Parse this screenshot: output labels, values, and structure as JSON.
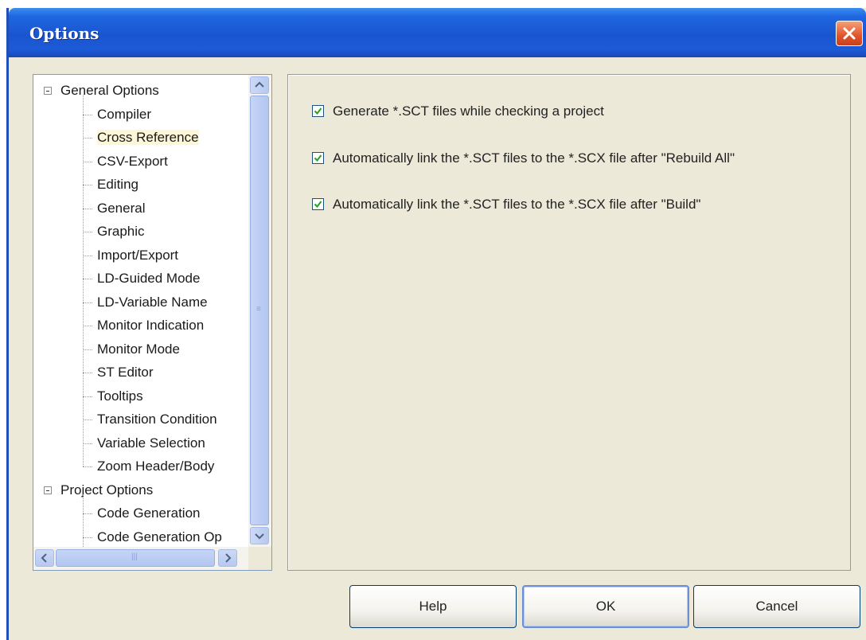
{
  "window": {
    "title": "Options"
  },
  "tree": {
    "items": [
      {
        "label": "General Options",
        "level": 0,
        "expanded": true
      },
      {
        "label": "Compiler",
        "level": 1
      },
      {
        "label": "Cross Reference",
        "level": 1,
        "selected": true
      },
      {
        "label": "CSV-Export",
        "level": 1
      },
      {
        "label": "Editing",
        "level": 1
      },
      {
        "label": "General",
        "level": 1
      },
      {
        "label": "Graphic",
        "level": 1
      },
      {
        "label": "Import/Export",
        "level": 1
      },
      {
        "label": "LD-Guided Mode",
        "level": 1
      },
      {
        "label": "LD-Variable Name",
        "level": 1
      },
      {
        "label": "Monitor Indication",
        "level": 1
      },
      {
        "label": "Monitor Mode",
        "level": 1
      },
      {
        "label": "ST Editor",
        "level": 1
      },
      {
        "label": "Tooltips",
        "level": 1
      },
      {
        "label": "Transition Condition",
        "level": 1
      },
      {
        "label": "Variable Selection",
        "level": 1
      },
      {
        "label": "Zoom Header/Body",
        "level": 1
      },
      {
        "label": "Project Options",
        "level": 0,
        "expanded": true
      },
      {
        "label": "Code Generation",
        "level": 1
      },
      {
        "label": "Code Generation Op",
        "level": 1
      }
    ]
  },
  "options": [
    {
      "label": "Generate *.SCT files while checking a project",
      "checked": true
    },
    {
      "label": "Automatically link the *.SCT files to the *.SCX file after \"Rebuild All\"",
      "checked": true
    },
    {
      "label": "Automatically link the *.SCT files to the *.SCX file after \"Build\"",
      "checked": true
    }
  ],
  "buttons": {
    "help": "Help",
    "ok": "OK",
    "cancel": "Cancel"
  },
  "colors": {
    "titlebar": "#1d5ad6",
    "dialog_bg": "#ece9d8",
    "close": "#e0542a"
  }
}
